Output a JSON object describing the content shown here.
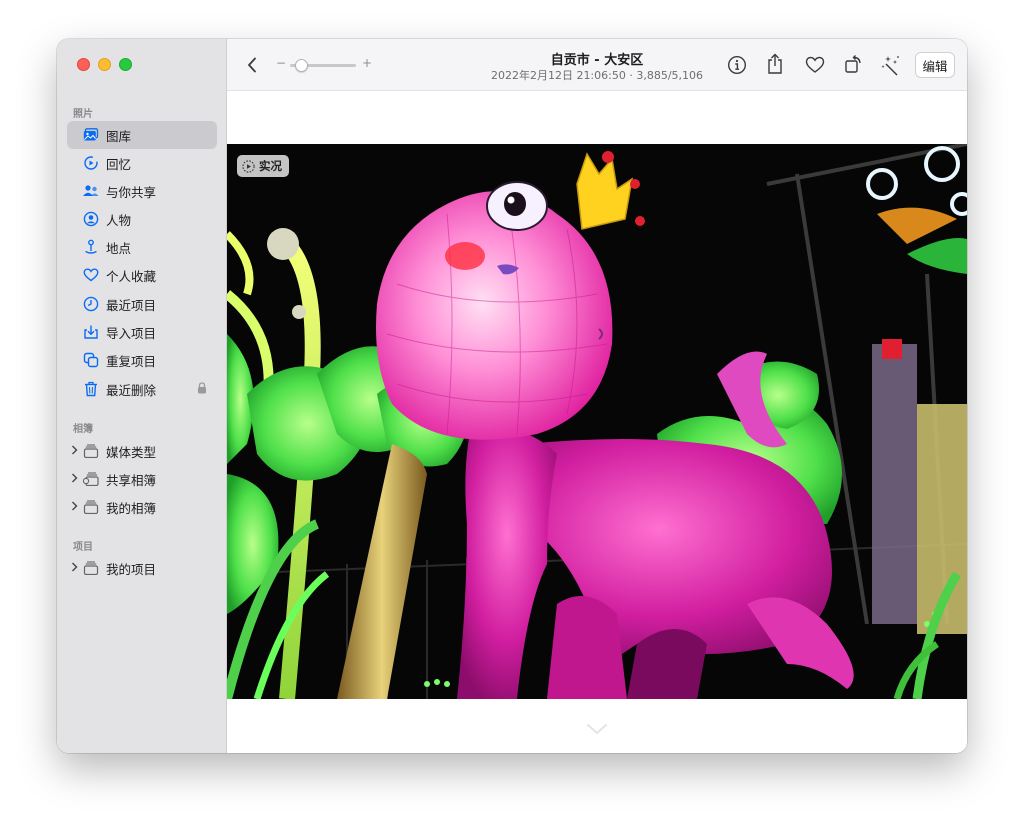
{
  "window": {
    "title": "自贡市 - 大安区",
    "subtitle": "2022年2月12日 21:06:50 · 3,885/5,106",
    "edit_label": "编辑",
    "zoom_minus": "−",
    "zoom_plus": "+",
    "zoom_level": 0.1
  },
  "sidebar": {
    "sections": [
      {
        "label": "照片",
        "items": [
          {
            "label": "图库",
            "icon": "library-icon",
            "selected": true
          },
          {
            "label": "回忆",
            "icon": "memories-icon"
          },
          {
            "label": "与你共享",
            "icon": "shared-with-you-icon"
          },
          {
            "label": "人物",
            "icon": "people-icon"
          },
          {
            "label": "地点",
            "icon": "places-icon"
          },
          {
            "label": "个人收藏",
            "icon": "heart-icon"
          },
          {
            "label": "最近项目",
            "icon": "clock-icon"
          },
          {
            "label": "导入项目",
            "icon": "import-icon"
          },
          {
            "label": "重复项目",
            "icon": "duplicates-icon"
          },
          {
            "label": "最近删除",
            "icon": "trash-icon",
            "locked": true
          }
        ]
      },
      {
        "label": "相簿",
        "items": [
          {
            "label": "媒体类型",
            "icon": "album-stack-icon"
          },
          {
            "label": "共享相簿",
            "icon": "shared-album-icon"
          },
          {
            "label": "我的相簿",
            "icon": "album-stack-icon"
          }
        ]
      },
      {
        "label": "项目",
        "items": [
          {
            "label": "我的项目",
            "icon": "album-stack-icon"
          }
        ]
      }
    ]
  },
  "photo": {
    "live_label": "实况"
  },
  "colors": {
    "accent": "#0a6cf5",
    "sidebar_bg": "#e3e3e5",
    "selected_bg": "#cbcbcf"
  }
}
